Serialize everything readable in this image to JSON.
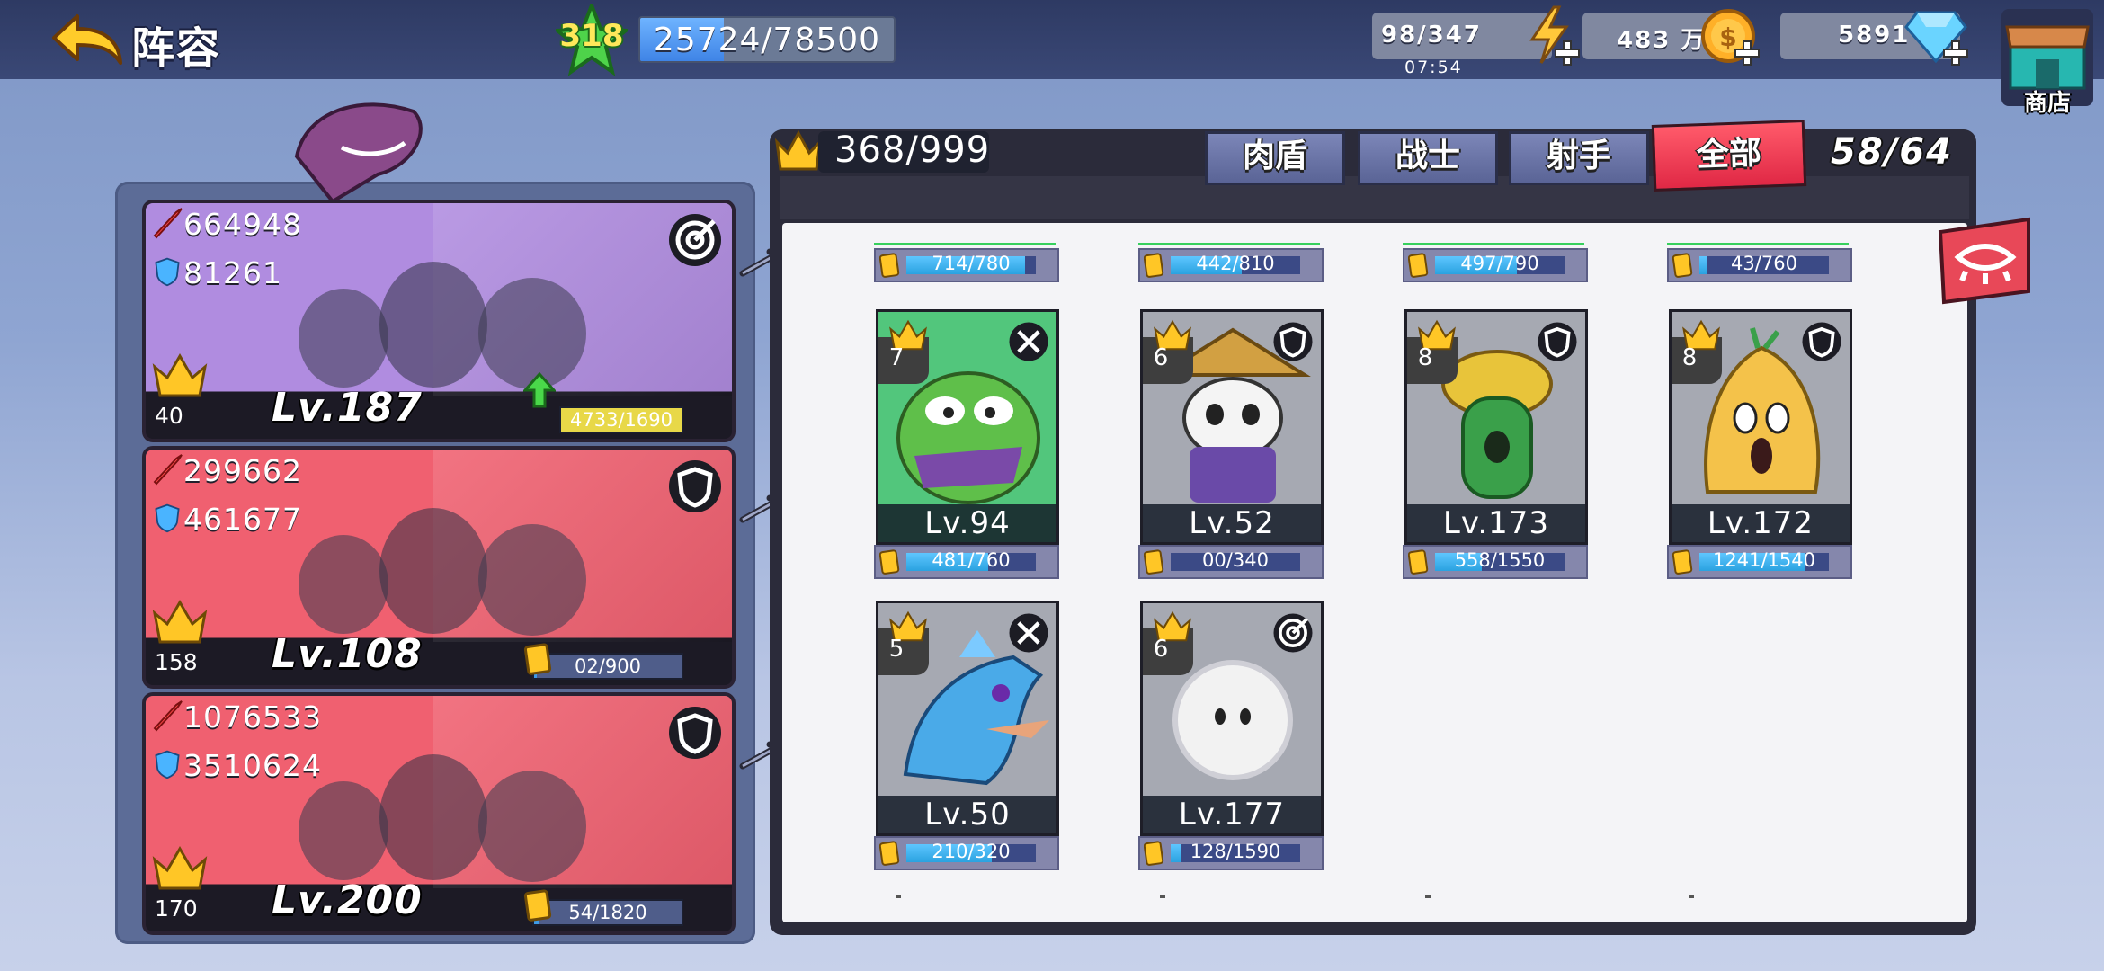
{
  "header": {
    "title": "阵容",
    "player_level": "318",
    "exp": {
      "current": 25724,
      "max": 78500,
      "text": "25724/78500",
      "progress": 0.33
    }
  },
  "resources": {
    "stamina": {
      "text": "98/347",
      "timer": "07:54"
    },
    "coins": {
      "text": "483",
      "unit": "万"
    },
    "gems": {
      "text": "5891"
    },
    "shop_label": "商店"
  },
  "teams": [
    {
      "attack": "664948",
      "defense": "81261",
      "role_icon": "target-icon",
      "stars": "40",
      "level": "Lv.187",
      "shards": "4733/1690",
      "shard_progress": 1.0,
      "shard_color": "#e8d848",
      "color": "#b08ce0"
    },
    {
      "attack": "299662",
      "defense": "461677",
      "role_icon": "shield-icon",
      "stars": "158",
      "level": "Lv.108",
      "shards": "02/900",
      "shard_progress": 0.02,
      "shard_color": "#3d9be8",
      "color": "#f06070"
    },
    {
      "attack": "1076533",
      "defense": "3510624",
      "role_icon": "shield-icon",
      "stars": "170",
      "level": "Lv.200",
      "shards": "54/1820",
      "shard_progress": 0.03,
      "shard_color": "#3d9be8",
      "color": "#f06070"
    }
  ],
  "collection": {
    "capacity": "368/999",
    "count": "58/64",
    "tabs": [
      "肉盾",
      "战士",
      "射手",
      "全部"
    ],
    "active_tab": "全部"
  },
  "top_bars": [
    {
      "text": "714/780",
      "progress": 0.92
    },
    {
      "text": "442/810",
      "progress": 0.55
    },
    {
      "text": "497/790",
      "progress": 0.63
    },
    {
      "text": "43/760",
      "progress": 0.06
    }
  ],
  "heroes": [
    {
      "name": "frog",
      "stars": "7",
      "role_icon": "swords-icon",
      "level": "Lv.94",
      "shards": "481/760",
      "progress": 0.63,
      "bg": "#3bbf6a"
    },
    {
      "name": "panda",
      "stars": "6",
      "role_icon": "shield-icon",
      "level": "Lv.52",
      "shards": "00/340",
      "progress": 0.0,
      "bg": "#9a9ea8"
    },
    {
      "name": "cactus",
      "stars": "8",
      "role_icon": "shield-icon",
      "level": "Lv.173",
      "shards": "558/1550",
      "progress": 0.36,
      "bg": "#9a9ea8"
    },
    {
      "name": "potato",
      "stars": "8",
      "role_icon": "shield-icon",
      "level": "Lv.172",
      "shards": "1241/1540",
      "progress": 0.81,
      "bg": "#9a9ea8"
    },
    {
      "name": "dragon",
      "stars": "5",
      "role_icon": "swords-icon",
      "level": "Lv.50",
      "shards": "210/320",
      "progress": 0.66,
      "bg": "#9a9ea8"
    },
    {
      "name": "furball",
      "stars": "6",
      "role_icon": "target-icon",
      "level": "Lv.177",
      "shards": "128/1590",
      "progress": 0.08,
      "bg": "#9a9ea8"
    }
  ]
}
